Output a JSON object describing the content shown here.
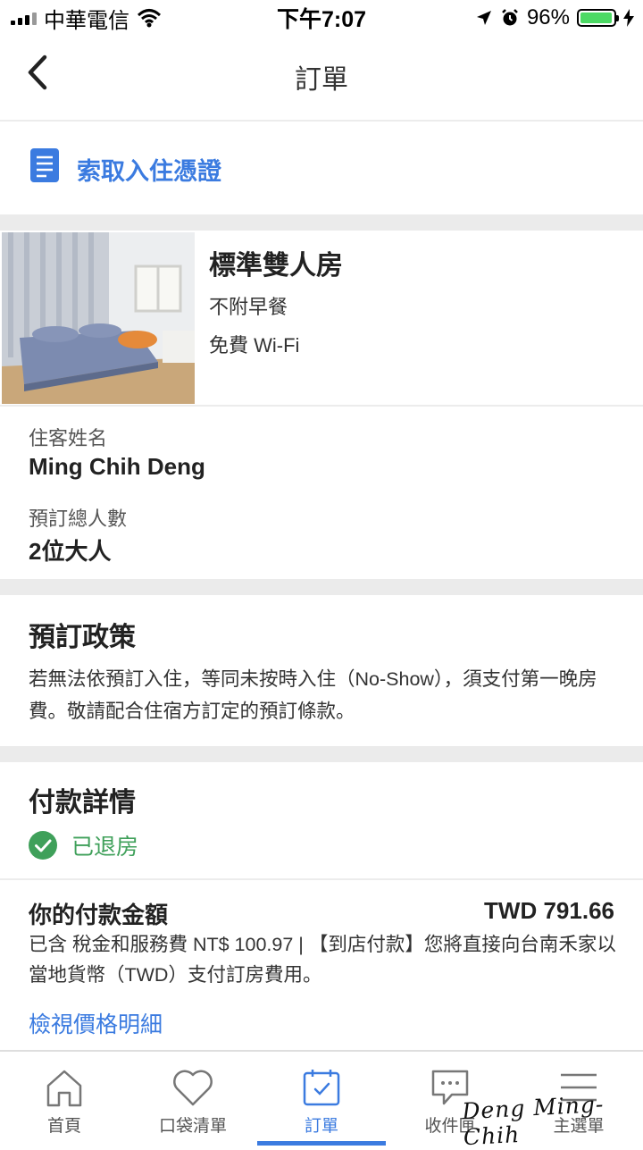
{
  "status_bar": {
    "carrier": "中華電信",
    "time": "下午7:07",
    "battery_percent": "96%",
    "battery_level": 0.96,
    "battery_color": "#4cd964"
  },
  "nav": {
    "title": "訂單",
    "back_icon": "chevron-left-icon"
  },
  "voucher": {
    "label": "索取入住憑證",
    "icon": "document-icon",
    "color": "#3b7be0"
  },
  "room": {
    "name": "標準雙人房",
    "breakfast": "不附早餐",
    "wifi": "免費 Wi-Fi"
  },
  "guest": {
    "name_label": "住客姓名",
    "name_value": "Ming Chih Deng",
    "count_label": "預訂總人數",
    "count_value": "2位大人"
  },
  "policy": {
    "title": "預訂政策",
    "text": "若無法依預訂入住，等同未按時入住（No-Show），須支付第一晚房費。敬請配合住宿方訂定的預訂條款。"
  },
  "payment": {
    "title": "付款詳情",
    "status": "已退房",
    "status_color": "#3fa05a",
    "amount_label": "你的付款金額",
    "amount_value": "TWD 791.66",
    "note": "已含 稅金和服務費 NT$ 100.97 | 【到店付款】您將直接向台南禾家以當地貨幣（TWD）支付訂房費用。",
    "price_link": "檢視價格明細"
  },
  "tabs": [
    {
      "label": "首頁",
      "icon": "home-icon",
      "active": false
    },
    {
      "label": "口袋清單",
      "icon": "heart-icon",
      "active": false
    },
    {
      "label": "訂單",
      "icon": "calendar-check-icon",
      "active": true
    },
    {
      "label": "收件匣",
      "icon": "chat-bubble-icon",
      "active": false
    },
    {
      "label": "主選單",
      "icon": "menu-icon",
      "active": false
    }
  ],
  "signature": "Deng Ming-Chih"
}
